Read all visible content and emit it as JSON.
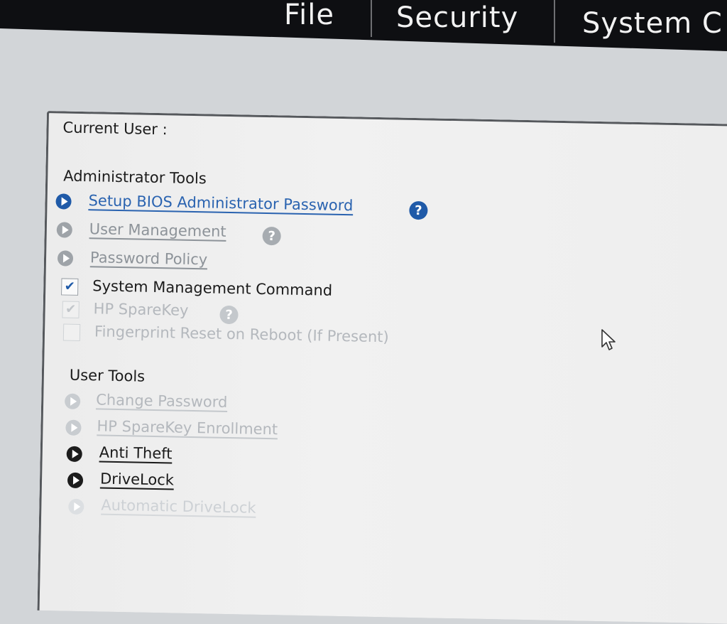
{
  "menubar": {
    "items": [
      {
        "label": "File"
      },
      {
        "label": "Security"
      },
      {
        "label": "System C"
      }
    ]
  },
  "panel": {
    "current_user_label": "Current User :",
    "admin_tools": {
      "heading": "Administrator Tools",
      "setup_bios_admin_password": "Setup BIOS Administrator Password",
      "user_management": "User Management",
      "password_policy": "Password Policy",
      "system_management_command": "System Management Command",
      "hp_sparekey": "HP SpareKey",
      "fingerprint_reset": "Fingerprint Reset on Reboot (If Present)"
    },
    "user_tools": {
      "heading": "User Tools",
      "change_password": "Change Password",
      "hp_sparekey_enrollment": "HP SpareKey Enrollment",
      "anti_theft": "Anti Theft",
      "drivelock": "DriveLock",
      "automatic_drivelock": "Automatic DriveLock"
    },
    "help_glyph": "?",
    "check_glyph": "✔"
  },
  "checkboxes": {
    "system_management_command": true,
    "hp_sparekey": true,
    "fingerprint_reset": false
  },
  "colors": {
    "accent": "#1f5aa8",
    "disabled": "#b4b8bd",
    "menubar": "#101114"
  },
  "icons": [
    "arrow-bullet-icon",
    "help-icon",
    "check-icon",
    "mouse-pointer-icon"
  ]
}
